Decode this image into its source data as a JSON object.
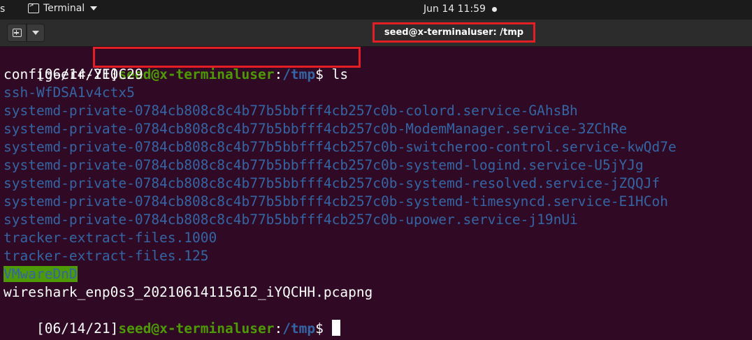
{
  "topbar": {
    "activities_fragment": "s",
    "app_name": "Terminal",
    "clock": "Jun 14  11:59"
  },
  "window": {
    "title": "seed@x-terminaluser: /tmp"
  },
  "terminal": {
    "prompt_date": "[06/14/21]",
    "prompt_user": "seed@x-terminaluser",
    "prompt_sep": ":",
    "prompt_path": "/tmp",
    "prompt_symbol": "$",
    "command": "ls",
    "files": [
      {
        "name": "config-err-YE0C29",
        "type": "file"
      },
      {
        "name": "ssh-WfDSA1v4ctx5",
        "type": "dir"
      },
      {
        "name": "systemd-private-0784cb808c8c4b77b5bbfff4cb257c0b-colord.service-GAhsBh",
        "type": "dir"
      },
      {
        "name": "systemd-private-0784cb808c8c4b77b5bbfff4cb257c0b-ModemManager.service-3ZChRe",
        "type": "dir"
      },
      {
        "name": "systemd-private-0784cb808c8c4b77b5bbfff4cb257c0b-switcheroo-control.service-kwQd7e",
        "type": "dir"
      },
      {
        "name": "systemd-private-0784cb808c8c4b77b5bbfff4cb257c0b-systemd-logind.service-U5jYJg",
        "type": "dir"
      },
      {
        "name": "systemd-private-0784cb808c8c4b77b5bbfff4cb257c0b-systemd-resolved.service-jZQQJf",
        "type": "dir"
      },
      {
        "name": "systemd-private-0784cb808c8c4b77b5bbfff4cb257c0b-systemd-timesyncd.service-E1HCoh",
        "type": "dir"
      },
      {
        "name": "systemd-private-0784cb808c8c4b77b5bbfff4cb257c0b-upower.service-j19nUi",
        "type": "dir"
      },
      {
        "name": "tracker-extract-files.1000",
        "type": "dir"
      },
      {
        "name": "tracker-extract-files.125",
        "type": "dir"
      },
      {
        "name": "VMwareDnD",
        "type": "sticky-dir"
      },
      {
        "name": "wireshark_enp0s3_20210614115612_iYQCHH.pcapng",
        "type": "file"
      }
    ]
  },
  "colors": {
    "terminal_bg": "#300a24",
    "dir_blue": "#3465a4",
    "prompt_green": "#4e9a06",
    "highlight_red": "#e31e24"
  }
}
